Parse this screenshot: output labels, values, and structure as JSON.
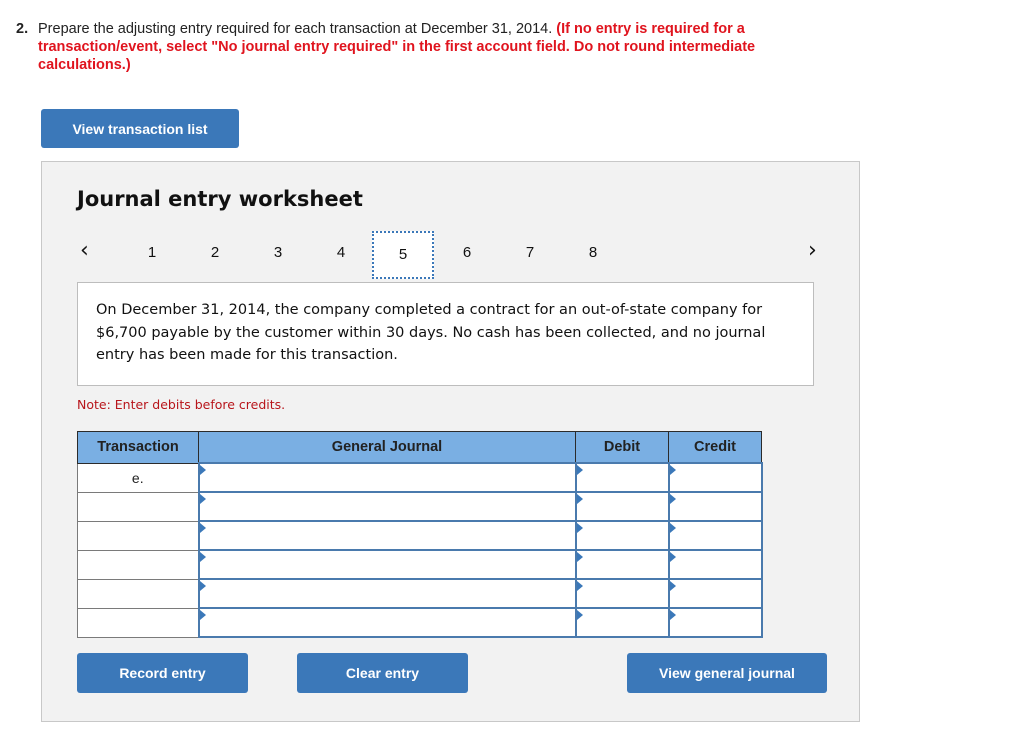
{
  "question": {
    "number": "2.",
    "text": "Prepare the adjusting entry required for each transaction at December 31, 2014.",
    "instruction": "(If no entry is required for a transaction/event, select \"No journal entry required\" in the first account field. Do not round intermediate calculations.)"
  },
  "buttons": {
    "view_transaction_list": "View transaction list",
    "record_entry": "Record entry",
    "clear_entry": "Clear entry",
    "view_general_journal": "View general journal"
  },
  "worksheet": {
    "title": "Journal entry worksheet",
    "pager": {
      "prev_icon": "‹",
      "next_icon": "›",
      "pages": [
        "1",
        "2",
        "3",
        "4",
        "5",
        "6",
        "7",
        "8"
      ],
      "active_page": "5"
    },
    "description": "On December 31, 2014, the company completed a contract for an out-of-state company for $6,700 payable by the customer within 30 days. No cash has been collected, and no journal entry has been made for this transaction.",
    "note": "Note: Enter debits before credits.",
    "table": {
      "headers": [
        "Transaction",
        "General Journal",
        "Debit",
        "Credit"
      ],
      "rows": [
        {
          "transaction": "e.",
          "account": "",
          "debit": "",
          "credit": ""
        },
        {
          "transaction": "",
          "account": "",
          "debit": "",
          "credit": ""
        },
        {
          "transaction": "",
          "account": "",
          "debit": "",
          "credit": ""
        },
        {
          "transaction": "",
          "account": "",
          "debit": "",
          "credit": ""
        },
        {
          "transaction": "",
          "account": "",
          "debit": "",
          "credit": ""
        },
        {
          "transaction": "",
          "account": "",
          "debit": "",
          "credit": ""
        }
      ]
    }
  },
  "colors": {
    "accent": "#3b78b9",
    "header_blue": "#7aafe3",
    "instruction_red": "#e0141e",
    "note_red": "#b8151b",
    "panel_bg": "#f2f2f2"
  }
}
